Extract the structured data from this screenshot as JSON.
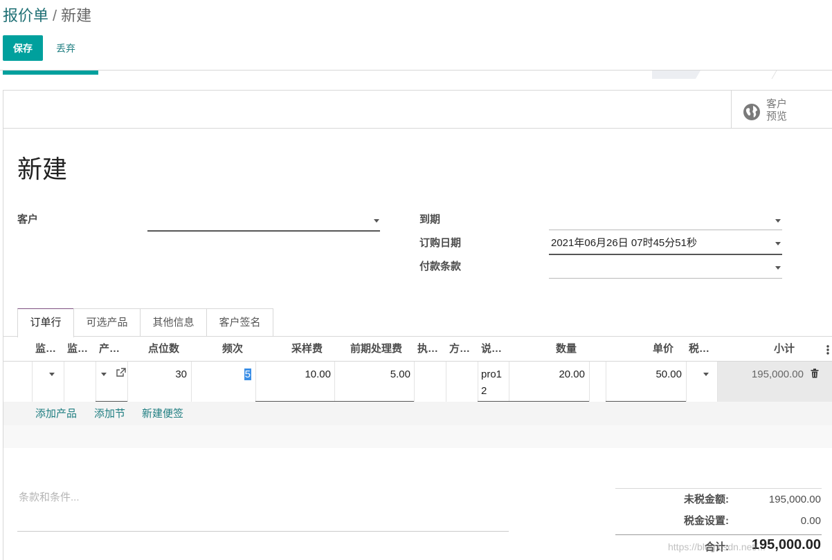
{
  "breadcrumb": {
    "parent": "报价单",
    "separator": "/",
    "current": "新建"
  },
  "toolbar": {
    "save_label": "保存",
    "discard_label": "丢弃"
  },
  "smart_buttons": {
    "customer_preview": "客户\n预览",
    "customer_preview_l1": "客户",
    "customer_preview_l2": "预览"
  },
  "record": {
    "title": "新建"
  },
  "fields": {
    "customer": {
      "label": "客户",
      "value": ""
    },
    "expiration": {
      "label": "到期",
      "value": ""
    },
    "order_date": {
      "label": "订购日期",
      "value": "2021年06月26日 07时45分51秒"
    },
    "payment_terms": {
      "label": "付款条款",
      "value": ""
    }
  },
  "tabs": [
    {
      "label": "订单行",
      "active": true
    },
    {
      "label": "可选产品",
      "active": false
    },
    {
      "label": "其他信息",
      "active": false
    },
    {
      "label": "客户签名",
      "active": false
    }
  ],
  "table": {
    "headers": [
      "监…",
      "监…",
      "产…",
      "点位数",
      "频次",
      "采样费",
      "前期处理费",
      "执…",
      "方…",
      "说…",
      "数量",
      "单价",
      "税…",
      "小计"
    ],
    "row": {
      "points": "30",
      "frequency": "5",
      "sampling_fee": "10.00",
      "pretreatment_fee": "5.00",
      "description_l1": "pro1",
      "description_l2": "2",
      "quantity": "20.00",
      "unit_price": "50.00",
      "subtotal": "195,000.00"
    },
    "add_links": {
      "add_product": "添加产品",
      "add_section": "添加节",
      "add_note": "新建便签"
    }
  },
  "notes": {
    "placeholder": "条款和条件..."
  },
  "totals": {
    "untaxed_label": "未税金额:",
    "untaxed_value": "195,000.00",
    "tax_label": "税金设置:",
    "tax_value": "0.00",
    "total_label": "合计:",
    "total_value": "195,000.00"
  },
  "watermark": "https://blog.csdn.net/...",
  "colors": {
    "primary": "#00a09d",
    "link": "#1e7d80",
    "active_tab_border": "#7c4f80"
  }
}
